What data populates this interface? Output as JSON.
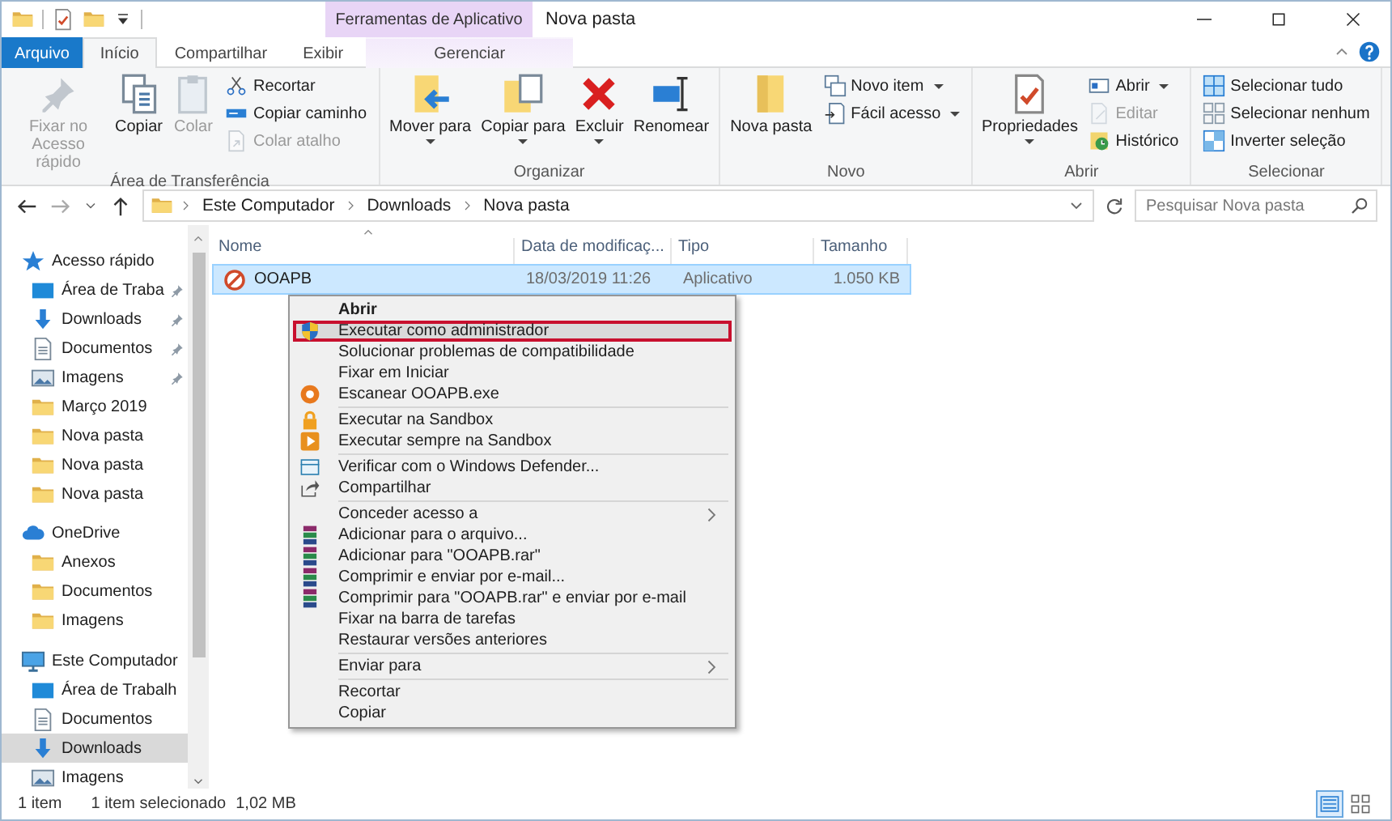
{
  "window": {
    "title": "Nova pasta",
    "context_tab": "Ferramentas de Aplicativo"
  },
  "ribbon_tabs": [
    {
      "label": "Arquivo",
      "kind": "file",
      "selected": false
    },
    {
      "label": "Início",
      "kind": "tab",
      "selected": true
    },
    {
      "label": "Compartilhar",
      "kind": "tab",
      "selected": false
    },
    {
      "label": "Exibir",
      "kind": "tab",
      "selected": false
    },
    {
      "label": "Gerenciar",
      "kind": "context",
      "selected": false
    }
  ],
  "ribbon_groups": [
    {
      "label": "Área de Transferência",
      "large_buttons": [
        {
          "label": "Fixar no Acesso rápido",
          "kind": "pin",
          "disabled": true,
          "dropdown": false
        },
        {
          "label": "Copiar",
          "kind": "copy",
          "disabled": false,
          "dropdown": false
        },
        {
          "label": "Colar",
          "kind": "paste",
          "disabled": true,
          "dropdown": false
        }
      ],
      "small_buttons": [
        {
          "label": "Recortar",
          "kind": "cut",
          "disabled": false,
          "dropdown": false
        },
        {
          "label": "Copiar caminho",
          "kind": "path",
          "disabled": false,
          "dropdown": false
        },
        {
          "label": "Colar atalho",
          "kind": "shortcut",
          "disabled": true,
          "dropdown": false
        }
      ]
    },
    {
      "label": "Organizar",
      "large_buttons": [
        {
          "label": "Mover para",
          "kind": "move",
          "disabled": false,
          "dropdown": true
        },
        {
          "label": "Copiar para",
          "kind": "copyto",
          "disabled": false,
          "dropdown": true
        },
        {
          "label": "Excluir",
          "kind": "delete",
          "disabled": false,
          "dropdown": true
        },
        {
          "label": "Renomear",
          "kind": "rename",
          "disabled": false,
          "dropdown": false
        }
      ]
    },
    {
      "label": "Novo",
      "large_buttons": [
        {
          "label": "Nova pasta",
          "kind": "newfolder",
          "disabled": false,
          "dropdown": false
        }
      ],
      "small_buttons": [
        {
          "label": "Novo item",
          "kind": "newitem",
          "disabled": false,
          "dropdown": true
        },
        {
          "label": "Fácil acesso",
          "kind": "easy",
          "disabled": false,
          "dropdown": true
        }
      ]
    },
    {
      "label": "Abrir",
      "large_buttons": [
        {
          "label": "Propriedades",
          "kind": "properties",
          "disabled": false,
          "dropdown": true
        }
      ],
      "small_buttons": [
        {
          "label": "Abrir",
          "kind": "open",
          "disabled": false,
          "dropdown": true
        },
        {
          "label": "Editar",
          "kind": "edit",
          "disabled": true,
          "dropdown": false
        },
        {
          "label": "Histórico",
          "kind": "history",
          "disabled": false,
          "dropdown": false
        }
      ]
    },
    {
      "label": "Selecionar",
      "small_buttons": [
        {
          "label": "Selecionar tudo",
          "kind": "selall",
          "disabled": false,
          "dropdown": false
        },
        {
          "label": "Selecionar nenhum",
          "kind": "selnone",
          "disabled": false,
          "dropdown": false
        },
        {
          "label": "Inverter seleção",
          "kind": "invert",
          "disabled": false,
          "dropdown": false
        }
      ]
    }
  ],
  "address": {
    "breadcrumbs": [
      "Este Computador",
      "Downloads",
      "Nova pasta"
    ],
    "search": {
      "placeholder": "Pesquisar Nova pasta"
    }
  },
  "sidebar": {
    "items": [
      {
        "label": "Acesso rápido",
        "kind": "star",
        "selected": false,
        "pinned": false,
        "children": [
          {
            "label": "Área de Traba",
            "kind": "desktop",
            "selected": false,
            "pinned": true
          },
          {
            "label": "Downloads",
            "kind": "download",
            "selected": false,
            "pinned": true
          },
          {
            "label": "Documentos",
            "kind": "document",
            "selected": false,
            "pinned": true
          },
          {
            "label": "Imagens",
            "kind": "picture",
            "selected": false,
            "pinned": true
          },
          {
            "label": "Março 2019",
            "kind": "folder",
            "selected": false,
            "pinned": false
          },
          {
            "label": "Nova pasta",
            "kind": "folder",
            "selected": false,
            "pinned": false
          },
          {
            "label": "Nova pasta",
            "kind": "folder",
            "selected": false,
            "pinned": false
          },
          {
            "label": "Nova pasta",
            "kind": "folder",
            "selected": false,
            "pinned": false
          }
        ]
      },
      {
        "label": "OneDrive",
        "kind": "cloud",
        "selected": false,
        "pinned": false,
        "children": [
          {
            "label": "Anexos",
            "kind": "folder",
            "selected": false,
            "pinned": false
          },
          {
            "label": "Documentos",
            "kind": "folder",
            "selected": false,
            "pinned": false
          },
          {
            "label": "Imagens",
            "kind": "folder",
            "selected": false,
            "pinned": false
          }
        ]
      },
      {
        "label": "Este Computador",
        "kind": "computer",
        "selected": false,
        "pinned": false,
        "children": [
          {
            "label": "Área de Trabalh",
            "kind": "desktop",
            "selected": false,
            "pinned": false
          },
          {
            "label": "Documentos",
            "kind": "document",
            "selected": false,
            "pinned": false
          },
          {
            "label": "Downloads",
            "kind": "download",
            "selected": true,
            "pinned": false
          },
          {
            "label": "Imagens",
            "kind": "picture",
            "selected": false,
            "pinned": false
          }
        ]
      }
    ]
  },
  "table": {
    "columns": [
      "Nome",
      "Data de modificaç...",
      "Tipo",
      "Tamanho"
    ],
    "rows": [
      {
        "cells": [
          "OOAPB",
          "18/03/2019 11:26",
          "Aplicativo",
          "1.050 KB"
        ],
        "selected": true
      }
    ]
  },
  "context_menu": {
    "groups": [
      [
        {
          "label": "Abrir",
          "kind": "plain",
          "default": true,
          "submenu": false,
          "highlighted": false
        },
        {
          "label": "Executar como administrador",
          "kind": "shield",
          "default": false,
          "submenu": false,
          "highlighted": true
        },
        {
          "label": "Solucionar problemas de compatibilidade",
          "kind": "plain",
          "default": false,
          "submenu": false,
          "highlighted": false
        },
        {
          "label": "Fixar em Iniciar",
          "kind": "plain",
          "default": false,
          "submenu": false,
          "highlighted": false
        },
        {
          "label": "Escanear OOAPB.exe",
          "kind": "scan",
          "default": false,
          "submenu": false,
          "highlighted": false
        }
      ],
      [
        {
          "label": "Executar na Sandbox",
          "kind": "padlock",
          "default": false,
          "submenu": false,
          "highlighted": false
        },
        {
          "label": "Executar sempre na Sandbox",
          "kind": "play",
          "default": false,
          "submenu": false,
          "highlighted": false
        }
      ],
      [
        {
          "label": "Verificar com o Windows Defender...",
          "kind": "window",
          "default": false,
          "submenu": false,
          "highlighted": false
        },
        {
          "label": "Compartilhar",
          "kind": "share",
          "default": false,
          "submenu": false,
          "highlighted": false
        }
      ],
      [
        {
          "label": "Conceder acesso a",
          "kind": "plain",
          "default": false,
          "submenu": true,
          "highlighted": false
        },
        {
          "label": "Adicionar para o arquivo...",
          "kind": "books",
          "default": false,
          "submenu": false,
          "highlighted": false
        },
        {
          "label": "Adicionar para \"OOAPB.rar\"",
          "kind": "books",
          "default": false,
          "submenu": false,
          "highlighted": false
        },
        {
          "label": "Comprimir e enviar por e-mail...",
          "kind": "books",
          "default": false,
          "submenu": false,
          "highlighted": false
        },
        {
          "label": "Comprimir para \"OOAPB.rar\" e enviar por e-mail",
          "kind": "books",
          "default": false,
          "submenu": false,
          "highlighted": false
        },
        {
          "label": "Fixar na barra de tarefas",
          "kind": "plain",
          "default": false,
          "submenu": false,
          "highlighted": false
        },
        {
          "label": "Restaurar versões anteriores",
          "kind": "plain",
          "default": false,
          "submenu": false,
          "highlighted": false
        }
      ],
      [
        {
          "label": "Enviar para",
          "kind": "plain",
          "default": false,
          "submenu": true,
          "highlighted": false
        }
      ],
      [
        {
          "label": "Recortar",
          "kind": "plain",
          "default": false,
          "submenu": false,
          "highlighted": false
        },
        {
          "label": "Copiar",
          "kind": "plain",
          "default": false,
          "submenu": false,
          "highlighted": false
        }
      ]
    ]
  },
  "status_bar": {
    "count": "1 item",
    "selection": "1 item selecionado",
    "size": "1,02 MB",
    "views": [
      {
        "kind": "details",
        "selected": true
      },
      {
        "kind": "tiles",
        "selected": false
      }
    ]
  }
}
